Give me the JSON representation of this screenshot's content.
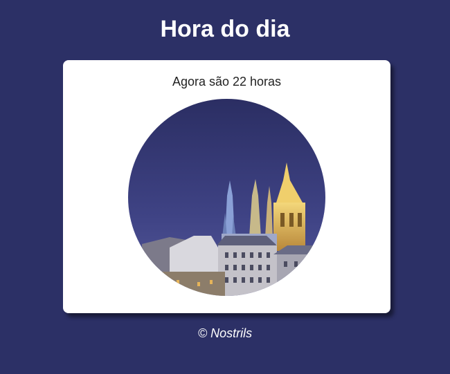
{
  "header": {
    "title": "Hora do dia"
  },
  "card": {
    "message": "Agora são 22 horas",
    "image": {
      "icon": "night-castle-photo"
    }
  },
  "footer": {
    "text": "© Nostrils"
  },
  "colors": {
    "background": "#2c3066",
    "card": "#ffffff",
    "title_text": "#ffffff",
    "message_text": "#222222"
  }
}
